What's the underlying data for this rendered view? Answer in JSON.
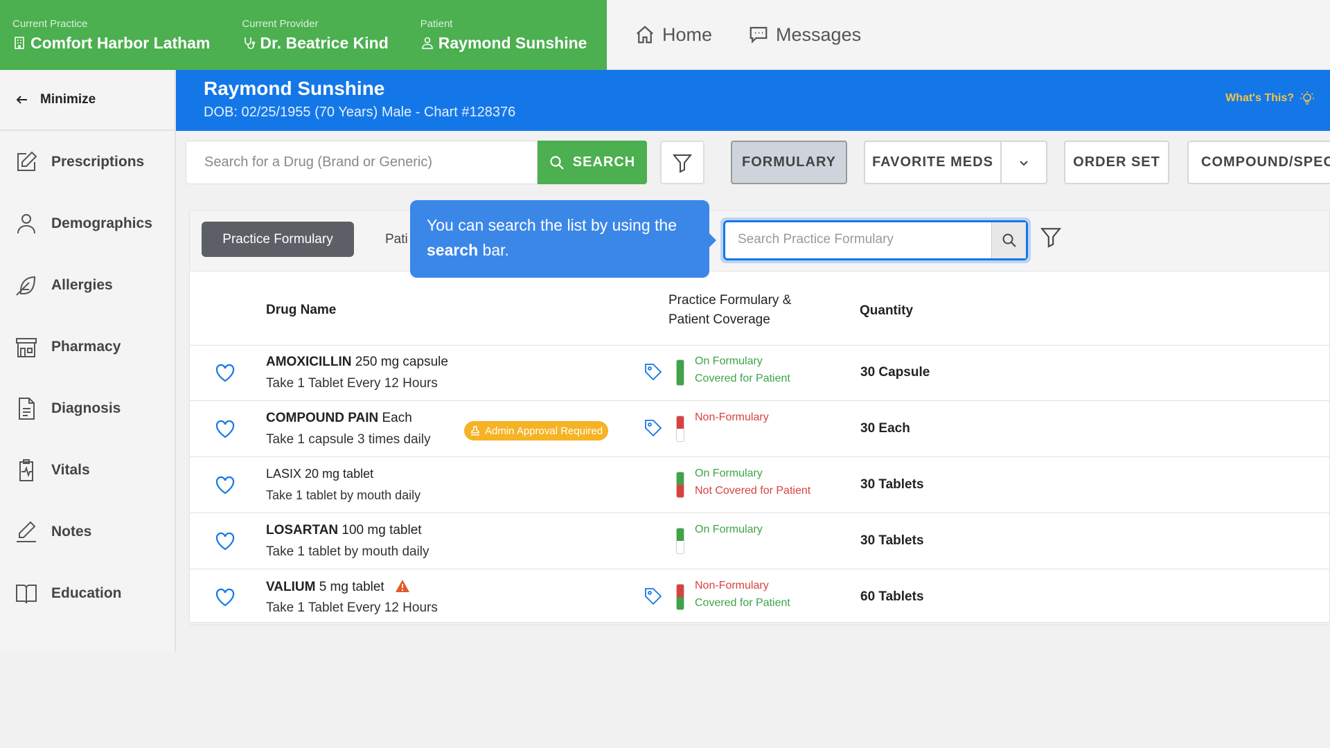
{
  "header": {
    "practice_label": "Current Practice",
    "practice_value": "Comfort Harbor Latham",
    "provider_label": "Current Provider",
    "provider_value": "Dr. Beatrice Kind",
    "patient_label": "Patient",
    "patient_value": "Raymond Sunshine",
    "nav_home": "Home",
    "nav_messages": "Messages"
  },
  "sidebar": {
    "minimize": "Minimize",
    "items": [
      {
        "label": "Prescriptions",
        "icon": "edit-icon"
      },
      {
        "label": "Demographics",
        "icon": "user-icon"
      },
      {
        "label": "Allergies",
        "icon": "feather-icon"
      },
      {
        "label": "Pharmacy",
        "icon": "store-icon"
      },
      {
        "label": "Diagnosis",
        "icon": "document-icon"
      },
      {
        "label": "Vitals",
        "icon": "clipboard-pulse-icon"
      },
      {
        "label": "Notes",
        "icon": "pencil-icon"
      },
      {
        "label": "Education",
        "icon": "book-icon"
      }
    ]
  },
  "banner": {
    "name": "Raymond Sunshine",
    "info": "DOB: 02/25/1955 (70 Years) Male - Chart #128376",
    "whats_this": "What's This?"
  },
  "search": {
    "placeholder": "Search for a Drug (Brand or Generic)",
    "button": "SEARCH"
  },
  "toolbar": {
    "formulary": "FORMULARY",
    "favorite_meds": "FAVORITE MEDS",
    "order_set": "ORDER SET",
    "compound": "COMPOUND/SPECI"
  },
  "formulary": {
    "tab_practice": "Practice Formulary",
    "tab_patient": "Pati",
    "search_placeholder": "Search Practice Formulary"
  },
  "tooltip": {
    "text_before": "You can search the list by using the ",
    "text_bold": "search",
    "text_after": " bar."
  },
  "table": {
    "col_drug": "Drug Name",
    "col_coverage_1": "Practice Formulary &",
    "col_coverage_2": "Patient Coverage",
    "col_quantity": "Quantity",
    "rows": [
      {
        "name": "AMOXICILLIN",
        "strength": " 250 mg capsule",
        "sig": "Take 1 Tablet Every 12 Hours",
        "status1": "On Formulary",
        "status2": "Covered for Patient",
        "qty": "30 Capsule"
      },
      {
        "name": "COMPOUND PAIN",
        "strength": " Each",
        "sig": "Take 1 capsule 3 times daily",
        "badge": "Admin Approval Required",
        "status1": "Non-Formulary",
        "status2": "",
        "qty": "30 Each"
      },
      {
        "name": "LASIX",
        "strength": " 20 mg tablet",
        "sig": "Take 1 tablet by mouth daily",
        "status1": "On Formulary",
        "status2": "Not Covered for Patient",
        "qty": "30 Tablets"
      },
      {
        "name": "LOSARTAN",
        "strength": " 100 mg tablet",
        "sig": "Take 1 tablet by mouth daily",
        "status1": "On Formulary",
        "status2": "",
        "qty": "30 Tablets"
      },
      {
        "name": "VALIUM",
        "strength": " 5 mg tablet",
        "sig": "Take 1 Tablet Every 12 Hours",
        "status1": "Non-Formulary",
        "status2": "Covered for Patient",
        "qty": "60 Tablets"
      }
    ]
  },
  "colors": {
    "header_green": "#4caf50",
    "banner_blue": "#1477e8",
    "status_green": "#3ea447",
    "status_red": "#d9413f",
    "badge_amber": "#f5b325"
  }
}
